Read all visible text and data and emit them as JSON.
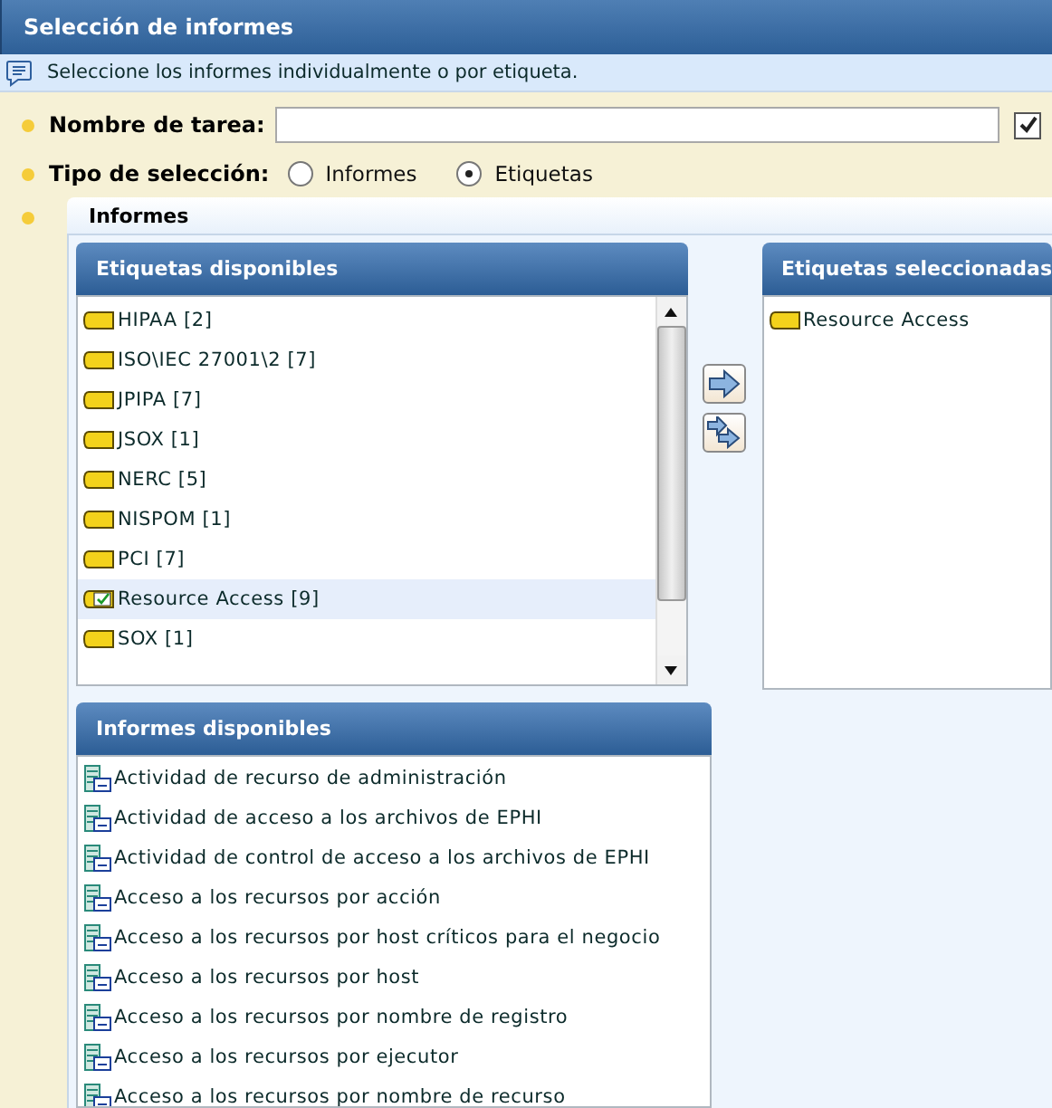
{
  "window": {
    "title": "Selección de informes"
  },
  "info": {
    "text": "Seleccione los informes individualmente o por etiqueta."
  },
  "task_name": {
    "label": "Nombre de tarea:",
    "checked": true
  },
  "selection_type": {
    "label": "Tipo de selección:",
    "options": [
      {
        "label": "Informes",
        "selected": false
      },
      {
        "label": "Etiquetas",
        "selected": true
      }
    ]
  },
  "reports_section": {
    "title": "Informes"
  },
  "available_tags": {
    "title": "Etiquetas disponibles",
    "items": [
      {
        "label": "HIPAA [2]",
        "selected": false
      },
      {
        "label": "ISO\\IEC 27001\\2 [7]",
        "selected": false
      },
      {
        "label": "JPIPA [7]",
        "selected": false
      },
      {
        "label": "JSOX [1]",
        "selected": false
      },
      {
        "label": "NERC [5]",
        "selected": false
      },
      {
        "label": "NISPOM [1]",
        "selected": false
      },
      {
        "label": "PCI [7]",
        "selected": false
      },
      {
        "label": "Resource Access [9]",
        "selected": true
      },
      {
        "label": "SOX [1]",
        "selected": false
      }
    ]
  },
  "selected_tags": {
    "title": "Etiquetas seleccionadas",
    "items": [
      "Resource Access"
    ]
  },
  "available_reports": {
    "title": "Informes disponibles",
    "items": [
      "Actividad de recurso de administración",
      "Actividad de acceso a los archivos de EPHI",
      "Actividad de control de acceso a los archivos de EPHI",
      "Acceso a los recursos por acción",
      "Acceso a los recursos por host críticos para el negocio",
      "Acceso a los recursos por host",
      "Acceso a los recursos por nombre de registro",
      "Acceso a los recursos por ejecutor",
      "Acceso a los recursos por nombre de recurso"
    ]
  }
}
